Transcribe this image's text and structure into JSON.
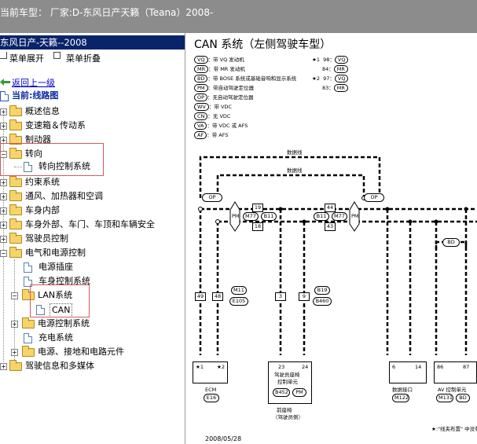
{
  "window": {
    "title": "当前车型：  厂家:D-东风日产天籁（Teana）2008-"
  },
  "left_panel": {
    "header": "东风日产-天籁--2008",
    "menu": {
      "expand": "菜单展开",
      "collapse": "菜单折叠"
    },
    "back_link": "返回上一级",
    "current": "当前:线路图",
    "tree": [
      "概述信息",
      "变速箱＆传动系",
      "制动器",
      "转向",
      "转向控制系统",
      "约束系统",
      "通风、加热器和空调",
      "车身内部",
      "车身外部、车门、车顶和车辆安全",
      "驾驶员控制",
      "电气和电源控制",
      "电源插座",
      "车身控制系统",
      "LAN系统",
      "CAN",
      "电源控制系统",
      "充电系统",
      "电源、接地和电路元件",
      "驾驶信息和多媒体"
    ]
  },
  "diagram": {
    "title": "CAN 系统（左侧驾驶车型）",
    "legend": [
      {
        "tag": "VQ",
        "text": "：带 VQ 发动机"
      },
      {
        "tag": "MR",
        "text": "：带 MR 发动机"
      },
      {
        "tag": "BD",
        "text": "：带 BOSE 系统或基础音响和显示系统"
      },
      {
        "tag": "PM",
        "text": "：带自动驾驶定位器"
      },
      {
        "tag": "OP",
        "text": "：无自动驾驶定位器"
      },
      {
        "tag": "WV",
        "text": "：带 VDC"
      },
      {
        "tag": "CN",
        "text": "：无 VDC"
      },
      {
        "tag": "VA",
        "text": "：带 VDC 或 AFS"
      },
      {
        "tag": "AF",
        "text": "：带 AFS"
      }
    ],
    "notes": [
      {
        "mark": "★1",
        "num": "98",
        "tag": "VQ"
      },
      {
        "mark": "",
        "num": "84",
        "tag": "MR"
      },
      {
        "mark": "★2",
        "num": "97",
        "tag": "VQ"
      },
      {
        "mark": "",
        "num": "83",
        "tag": "MR"
      }
    ],
    "wire_labels": {
      "upper": "数据线",
      "lower": "数据线"
    },
    "tags": {
      "op1": "OP",
      "op2": "OP",
      "pm1": "PM",
      "pm2": "PM",
      "bd": "BD"
    },
    "connectors": {
      "m77a": "M77",
      "b11a": "B11",
      "b11b": "B11",
      "m77b": "M77",
      "n19": "19",
      "n18": "18",
      "n44": "44",
      "n43": "43",
      "n49": "49",
      "n48": "48",
      "m11": "M11",
      "e105": "E105",
      "n3": "3",
      "n9": "9",
      "b19": "B19",
      "b460": "B460"
    },
    "modules": {
      "ecm": {
        "p1": "★1",
        "p2": "★2",
        "name": "ECM",
        "conn": "E16"
      },
      "seat": {
        "p1": "23",
        "p2": "24",
        "line1": "驾驶员座椅",
        "line2": "控制单元",
        "conn": "B452",
        "tag": "PM",
        "name1": "前座椅",
        "name2": "（驾驶员侧）"
      },
      "dlc": {
        "p1": "6",
        "p2": "14",
        "name": "数据接口",
        "conn": "M122"
      },
      "av": {
        "p1": "86",
        "p2": "87",
        "name": "AV 控制单元",
        "conn": "M131",
        "tag": "BD"
      }
    },
    "footnote": "★:\"线夹布置\" 中没有",
    "date": "2008/05/28"
  },
  "colors": {
    "header_bg": "#0a246a",
    "topbar_bg": "#8c8c8c",
    "highlight": "#d45a5a",
    "link": "#0000cc"
  }
}
